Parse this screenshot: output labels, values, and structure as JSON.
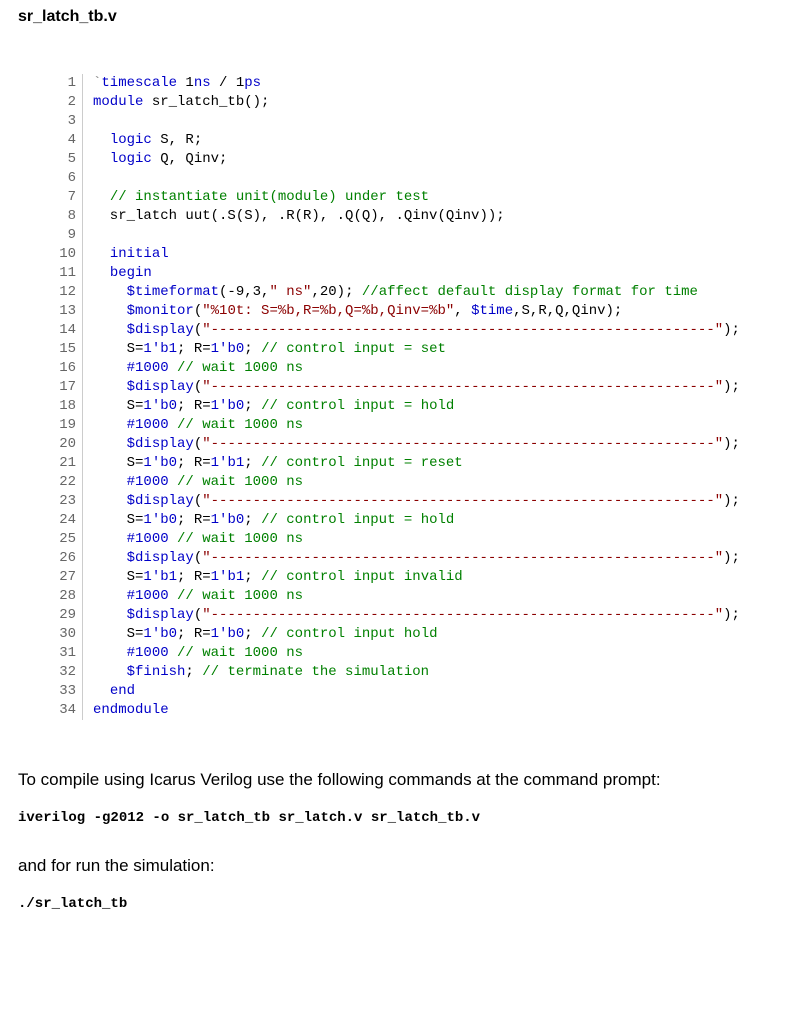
{
  "filename": "sr_latch_tb.v",
  "code": [
    {
      "n": "1",
      "t": [
        {
          "c": "gray",
          "s": "`"
        },
        {
          "c": "blue",
          "s": "timescale"
        },
        {
          "c": "black",
          "s": " 1"
        },
        {
          "c": "blue",
          "s": "ns"
        },
        {
          "c": "black",
          "s": " / 1"
        },
        {
          "c": "blue",
          "s": "ps"
        }
      ]
    },
    {
      "n": "2",
      "t": [
        {
          "c": "blue",
          "s": "module"
        },
        {
          "c": "black",
          "s": " sr_latch_tb();"
        }
      ]
    },
    {
      "n": "3",
      "t": []
    },
    {
      "n": "4",
      "t": [
        {
          "c": "black",
          "s": "  "
        },
        {
          "c": "blue",
          "s": "logic"
        },
        {
          "c": "black",
          "s": " S, R;"
        }
      ]
    },
    {
      "n": "5",
      "t": [
        {
          "c": "black",
          "s": "  "
        },
        {
          "c": "blue",
          "s": "logic"
        },
        {
          "c": "black",
          "s": " Q, Qinv;"
        }
      ]
    },
    {
      "n": "6",
      "t": []
    },
    {
      "n": "7",
      "t": [
        {
          "c": "black",
          "s": "  "
        },
        {
          "c": "green",
          "s": "// instantiate unit(module) under test"
        }
      ]
    },
    {
      "n": "8",
      "t": [
        {
          "c": "black",
          "s": "  sr_latch uut(.S(S), .R(R), .Q(Q), .Qinv(Qinv));"
        }
      ]
    },
    {
      "n": "9",
      "t": []
    },
    {
      "n": "10",
      "t": [
        {
          "c": "black",
          "s": "  "
        },
        {
          "c": "blue",
          "s": "initial"
        }
      ]
    },
    {
      "n": "11",
      "t": [
        {
          "c": "black",
          "s": "  "
        },
        {
          "c": "blue",
          "s": "begin"
        }
      ]
    },
    {
      "n": "12",
      "t": [
        {
          "c": "black",
          "s": "    "
        },
        {
          "c": "blue",
          "s": "$timeformat"
        },
        {
          "c": "black",
          "s": "(-9,3,"
        },
        {
          "c": "darkred",
          "s": "\" ns\""
        },
        {
          "c": "black",
          "s": ",20); "
        },
        {
          "c": "green",
          "s": "//affect default display format for time"
        }
      ]
    },
    {
      "n": "13",
      "t": [
        {
          "c": "black",
          "s": "    "
        },
        {
          "c": "blue",
          "s": "$monitor"
        },
        {
          "c": "black",
          "s": "("
        },
        {
          "c": "darkred",
          "s": "\"%10t: S=%b,R=%b,Q=%b,Qinv=%b\""
        },
        {
          "c": "black",
          "s": ", "
        },
        {
          "c": "blue",
          "s": "$time"
        },
        {
          "c": "black",
          "s": ",S,R,Q,Qinv);"
        }
      ]
    },
    {
      "n": "14",
      "t": [
        {
          "c": "black",
          "s": "    "
        },
        {
          "c": "blue",
          "s": "$display"
        },
        {
          "c": "black",
          "s": "("
        },
        {
          "c": "darkred",
          "s": "\"------------------------------------------------------------\""
        },
        {
          "c": "black",
          "s": ");"
        }
      ]
    },
    {
      "n": "15",
      "t": [
        {
          "c": "black",
          "s": "    S="
        },
        {
          "c": "blue",
          "s": "1'b1"
        },
        {
          "c": "black",
          "s": "; R="
        },
        {
          "c": "blue",
          "s": "1'b0"
        },
        {
          "c": "black",
          "s": "; "
        },
        {
          "c": "green",
          "s": "// control input = set"
        }
      ]
    },
    {
      "n": "16",
      "t": [
        {
          "c": "black",
          "s": "    "
        },
        {
          "c": "blue",
          "s": "#1000"
        },
        {
          "c": "black",
          "s": " "
        },
        {
          "c": "green",
          "s": "// wait 1000 ns"
        }
      ]
    },
    {
      "n": "17",
      "t": [
        {
          "c": "black",
          "s": "    "
        },
        {
          "c": "blue",
          "s": "$display"
        },
        {
          "c": "black",
          "s": "("
        },
        {
          "c": "darkred",
          "s": "\"------------------------------------------------------------\""
        },
        {
          "c": "black",
          "s": ");"
        }
      ]
    },
    {
      "n": "18",
      "t": [
        {
          "c": "black",
          "s": "    S="
        },
        {
          "c": "blue",
          "s": "1'b0"
        },
        {
          "c": "black",
          "s": "; R="
        },
        {
          "c": "blue",
          "s": "1'b0"
        },
        {
          "c": "black",
          "s": "; "
        },
        {
          "c": "green",
          "s": "// control input = hold"
        }
      ]
    },
    {
      "n": "19",
      "t": [
        {
          "c": "black",
          "s": "    "
        },
        {
          "c": "blue",
          "s": "#1000"
        },
        {
          "c": "black",
          "s": " "
        },
        {
          "c": "green",
          "s": "// wait 1000 ns"
        }
      ]
    },
    {
      "n": "20",
      "t": [
        {
          "c": "black",
          "s": "    "
        },
        {
          "c": "blue",
          "s": "$display"
        },
        {
          "c": "black",
          "s": "("
        },
        {
          "c": "darkred",
          "s": "\"------------------------------------------------------------\""
        },
        {
          "c": "black",
          "s": ");"
        }
      ]
    },
    {
      "n": "21",
      "t": [
        {
          "c": "black",
          "s": "    S="
        },
        {
          "c": "blue",
          "s": "1'b0"
        },
        {
          "c": "black",
          "s": "; R="
        },
        {
          "c": "blue",
          "s": "1'b1"
        },
        {
          "c": "black",
          "s": "; "
        },
        {
          "c": "green",
          "s": "// control input = reset"
        }
      ]
    },
    {
      "n": "22",
      "t": [
        {
          "c": "black",
          "s": "    "
        },
        {
          "c": "blue",
          "s": "#1000"
        },
        {
          "c": "black",
          "s": " "
        },
        {
          "c": "green",
          "s": "// wait 1000 ns"
        }
      ]
    },
    {
      "n": "23",
      "t": [
        {
          "c": "black",
          "s": "    "
        },
        {
          "c": "blue",
          "s": "$display"
        },
        {
          "c": "black",
          "s": "("
        },
        {
          "c": "darkred",
          "s": "\"------------------------------------------------------------\""
        },
        {
          "c": "black",
          "s": ");"
        }
      ]
    },
    {
      "n": "24",
      "t": [
        {
          "c": "black",
          "s": "    S="
        },
        {
          "c": "blue",
          "s": "1'b0"
        },
        {
          "c": "black",
          "s": "; R="
        },
        {
          "c": "blue",
          "s": "1'b0"
        },
        {
          "c": "black",
          "s": "; "
        },
        {
          "c": "green",
          "s": "// control input = hold"
        }
      ]
    },
    {
      "n": "25",
      "t": [
        {
          "c": "black",
          "s": "    "
        },
        {
          "c": "blue",
          "s": "#1000"
        },
        {
          "c": "black",
          "s": " "
        },
        {
          "c": "green",
          "s": "// wait 1000 ns"
        }
      ]
    },
    {
      "n": "26",
      "t": [
        {
          "c": "black",
          "s": "    "
        },
        {
          "c": "blue",
          "s": "$display"
        },
        {
          "c": "black",
          "s": "("
        },
        {
          "c": "darkred",
          "s": "\"------------------------------------------------------------\""
        },
        {
          "c": "black",
          "s": ");"
        }
      ]
    },
    {
      "n": "27",
      "t": [
        {
          "c": "black",
          "s": "    S="
        },
        {
          "c": "blue",
          "s": "1'b1"
        },
        {
          "c": "black",
          "s": "; R="
        },
        {
          "c": "blue",
          "s": "1'b1"
        },
        {
          "c": "black",
          "s": "; "
        },
        {
          "c": "green",
          "s": "// control input invalid"
        }
      ]
    },
    {
      "n": "28",
      "t": [
        {
          "c": "black",
          "s": "    "
        },
        {
          "c": "blue",
          "s": "#1000"
        },
        {
          "c": "black",
          "s": " "
        },
        {
          "c": "green",
          "s": "// wait 1000 ns"
        }
      ]
    },
    {
      "n": "29",
      "t": [
        {
          "c": "black",
          "s": "    "
        },
        {
          "c": "blue",
          "s": "$display"
        },
        {
          "c": "black",
          "s": "("
        },
        {
          "c": "darkred",
          "s": "\"------------------------------------------------------------\""
        },
        {
          "c": "black",
          "s": ");"
        }
      ]
    },
    {
      "n": "30",
      "t": [
        {
          "c": "black",
          "s": "    S="
        },
        {
          "c": "blue",
          "s": "1'b0"
        },
        {
          "c": "black",
          "s": "; R="
        },
        {
          "c": "blue",
          "s": "1'b0"
        },
        {
          "c": "black",
          "s": "; "
        },
        {
          "c": "green",
          "s": "// control input hold"
        }
      ]
    },
    {
      "n": "31",
      "t": [
        {
          "c": "black",
          "s": "    "
        },
        {
          "c": "blue",
          "s": "#1000"
        },
        {
          "c": "black",
          "s": " "
        },
        {
          "c": "green",
          "s": "// wait 1000 ns"
        }
      ]
    },
    {
      "n": "32",
      "t": [
        {
          "c": "black",
          "s": "    "
        },
        {
          "c": "blue",
          "s": "$finish"
        },
        {
          "c": "black",
          "s": "; "
        },
        {
          "c": "green",
          "s": "// terminate the simulation"
        }
      ]
    },
    {
      "n": "33",
      "t": [
        {
          "c": "black",
          "s": "  "
        },
        {
          "c": "blue",
          "s": "end"
        }
      ]
    },
    {
      "n": "34",
      "t": [
        {
          "c": "blue",
          "s": "endmodule"
        }
      ]
    }
  ],
  "text1": "To compile using Icarus Verilog use the following commands at the command prompt:",
  "cmd1": "iverilog -g2012 -o sr_latch_tb sr_latch.v sr_latch_tb.v",
  "text2": "and for run the simulation:",
  "cmd2": "./sr_latch_tb"
}
